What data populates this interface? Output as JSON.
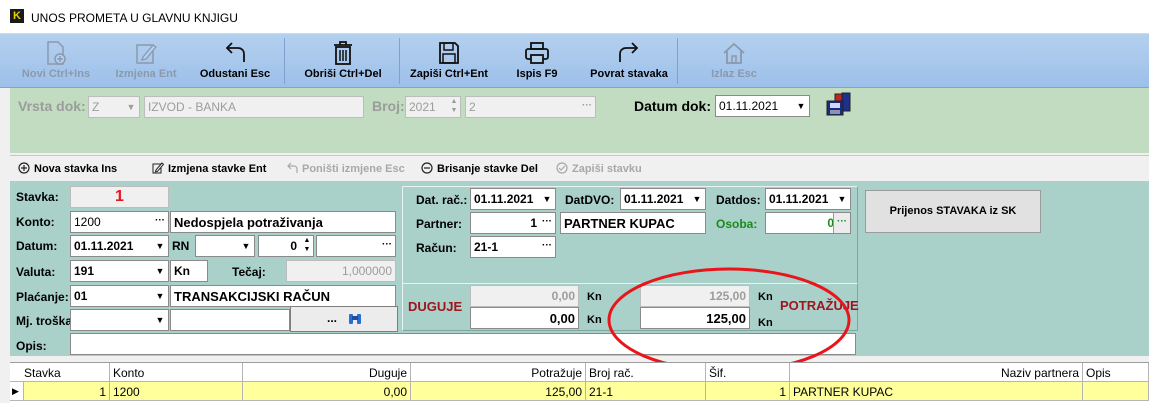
{
  "window": {
    "title": "UNOS PROMETA U GLAVNU KNJIGU",
    "logo": "K"
  },
  "toolbar": {
    "new": "Novi Ctrl+Ins",
    "edit": "Izmjena Ent",
    "cancel": "Odustani Esc",
    "delete": "Obriši Ctrl+Del",
    "save": "Zapiši Ctrl+Ent",
    "print": "Ispis F9",
    "return": "Povrat  stavaka",
    "exit": "Izlaz Esc"
  },
  "doc": {
    "vrsta_label": "Vrsta dok:",
    "vrsta_code": "Z",
    "vrsta_name": "IZVOD - BANKA",
    "broj_label": "Broj:",
    "broj_year": "2021",
    "broj_num": "2",
    "datum_label": "Datum dok:",
    "datum_value": "01.11.2021"
  },
  "stavka_toolbar": {
    "new": "Nova stavka Ins",
    "edit": "Izmjena stavke Ent",
    "undo": "Poništi izmjene Esc",
    "delete": "Brisanje stavke Del",
    "save": "Zapiši stavku"
  },
  "detail": {
    "stavka_label": "Stavka:",
    "stavka_value": "1",
    "konto_label": "Konto:",
    "konto_value": "1200",
    "konto_name": "Nedospjela potraživanja",
    "datum_label": "Datum:",
    "datum_value": "01.11.2021",
    "rn_label": "RN",
    "rn_num": "0",
    "valuta_label": "Valuta:",
    "valuta_value": "191",
    "valuta_name": "Kn",
    "tecaj_label": "Tečaj:",
    "tecaj_value": "1,000000",
    "placanje_label": "Plaćanje:",
    "placanje_code": "01",
    "placanje_name": "TRANSAKCIJSKI RAČUN",
    "mjtroska_label": "Mj. troška:",
    "mjtroska_btn": "...",
    "opis_label": "Opis:",
    "datrac_label": "Dat. rač.:",
    "datrac_value": "01.11.2021",
    "datdvo_label": "DatDVO:",
    "datdvo_value": "01.11.2021",
    "datdos_label": "Datdos:",
    "datdos_value": "01.11.2021",
    "partner_label": "Partner:",
    "partner_id": "1",
    "partner_name": "PARTNER KUPAC",
    "osoba_label": "Osoba:",
    "osoba_value": "0",
    "racun_label": "Račun:",
    "racun_value": "21-1",
    "prijenos_btn": "Prijenos STAVAKA iz SK",
    "duguje_label": "DUGUJE",
    "duguje_prev": "0,00",
    "duguje_value": "0,00",
    "potrazuje_label": "POTRAŽUJE",
    "potrazuje_prev": "125,00",
    "potrazuje_value": "125,00",
    "currency": "Kn"
  },
  "grid": {
    "headers": [
      "Stavka",
      "Konto",
      "Duguje",
      "Potražuje",
      "Broj rač.",
      "Šif.",
      "Naziv partnera",
      "Opis"
    ],
    "rows": [
      [
        "1",
        "1200",
        "0,00",
        "125,00",
        "21-1",
        "1",
        "PARTNER KUPAC",
        ""
      ]
    ]
  },
  "colors": {
    "annotation": "#e8161b",
    "highlight_row": "#ffff9c",
    "stavka_number": "#e8161b",
    "osoba_label": "#1d8a1d",
    "amount_label": "#a0141e"
  }
}
